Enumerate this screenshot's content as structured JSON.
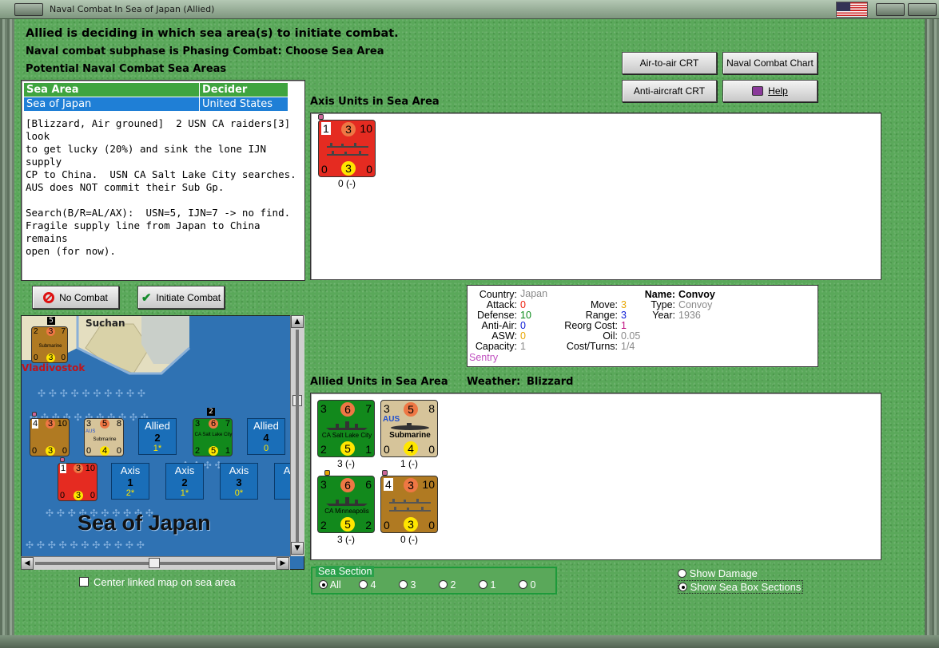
{
  "window": {
    "title": "Naval Combat In Sea of Japan (Allied)"
  },
  "status": {
    "line1": "Allied is deciding in which sea area(s) to initiate combat.",
    "line2": "Naval combat subphase is Phasing Combat: Choose Sea Area",
    "line3": "Potential Naval Combat Sea Areas"
  },
  "sea_table": {
    "headers": [
      "Sea Area",
      "Decider"
    ],
    "rows": [
      [
        "Sea of Japan",
        "United States"
      ]
    ]
  },
  "notes": "[Blizzard, Air grouned]  2 USN CA raiders[3] look\nto get lucky (20%) and sink the lone IJN supply\nCP to China.  USN CA Salt Lake City searches.\nAUS does NOT commit their Sub Gp.\n\nSearch(B/R=AL/AX):  USN=5, IJN=7 -> no find.\nFragile supply line from Japan to China remains\nopen (for now).",
  "buttons": {
    "air_to_air": "Air-to-air CRT",
    "naval_chart": "Naval Combat Chart",
    "anti_aircraft": "Anti-aircraft CRT",
    "help": "Help",
    "no_combat": "No Combat",
    "initiate_combat": "Initiate Combat"
  },
  "axis_section": {
    "label": "Axis Units in Sea Area",
    "unit": {
      "tl": "1",
      "tc": "3",
      "tr": "10",
      "bl": "0",
      "bc": "3",
      "br": "0",
      "under": "0 (-)"
    }
  },
  "info": {
    "country_k": "Country:",
    "country_v": "Japan",
    "attack_k": "Attack:",
    "attack_v": "0",
    "defense_k": "Defense:",
    "defense_v": "10",
    "antiair_k": "Anti-Air:",
    "antiair_v": "0",
    "asw_k": "ASW:",
    "asw_v": "0",
    "capacity_k": "Capacity:",
    "capacity_v": "1",
    "sentry": "Sentry",
    "move_k": "Move:",
    "move_v": "3",
    "range_k": "Range:",
    "range_v": "3",
    "reorg_k": "Reorg Cost:",
    "reorg_v": "1",
    "oil_k": "Oil:",
    "oil_v": "0.05",
    "cost_k": "Cost/Turns:",
    "cost_v": "1/4",
    "name_k": "Name:",
    "name_v": "Convoy",
    "type_k": "Type:",
    "type_v": "Convoy",
    "year_k": "Year:",
    "year_v": "1936"
  },
  "allied_section": {
    "label": "Allied Units in Sea Area",
    "weather_k": "Weather:",
    "weather_v": "Blizzard",
    "units": [
      {
        "tl": "3",
        "tc": "6",
        "tr": "7",
        "bl": "2",
        "bc": "5",
        "br": "1",
        "name": "CA Salt Lake City",
        "under": "3 (-)"
      },
      {
        "tl": "3",
        "tc": "5",
        "tr": "8",
        "bl": "0",
        "bc": "4",
        "br": "0",
        "name": "Submarine",
        "nation": "AUS",
        "under": "1 (-)"
      },
      {
        "tl": "3",
        "tc": "6",
        "tr": "6",
        "bl": "2",
        "bc": "5",
        "br": "2",
        "name": "CA Minneapolis",
        "under": "3 (-)"
      },
      {
        "tl": "4",
        "tc": "3",
        "tr": "10",
        "bl": "0",
        "bc": "3",
        "br": "0",
        "under": "0 (-)"
      }
    ]
  },
  "map": {
    "title": "Sea of Japan",
    "suchan": "Suchan",
    "vladivostok": "Vladivostok",
    "stack_count_1": "5",
    "stack_count_2": "2",
    "sub_counter": {
      "tl": "2",
      "tc": "3",
      "tr": "7",
      "bl": "0",
      "bc": "3",
      "br": "0",
      "name": "Submarine"
    },
    "row1": [
      {
        "tl": "4",
        "tc": "3",
        "tr": "10",
        "bl": "0",
        "bc": "3",
        "br": "0"
      },
      {
        "tl": "3",
        "tc": "5",
        "tr": "8",
        "bl": "0",
        "bc": "4",
        "br": "0",
        "name": "Submarine",
        "nation": "AUS"
      },
      {
        "a": "Allied",
        "b": "2",
        "c": "1*"
      },
      {
        "tl": "3",
        "tc": "6",
        "tr": "7",
        "bl": "2",
        "bc": "5",
        "br": "1",
        "name": "CA Salt Lake City"
      },
      {
        "a": "Allied",
        "b": "4",
        "c": "0"
      }
    ],
    "row2": [
      {
        "tl": "1",
        "tc": "3",
        "tr": "10",
        "bl": "0",
        "bc": "3",
        "br": "0"
      },
      {
        "a": "Axis",
        "b": "1",
        "c": "2*"
      },
      {
        "a": "Axis",
        "b": "2",
        "c": "1*"
      },
      {
        "a": "Axis",
        "b": "3",
        "c": "0*"
      },
      {
        "a": "Axis"
      }
    ]
  },
  "center_map": "Center linked map on sea area",
  "sea_section": {
    "legend": "Sea Section",
    "options": [
      "All",
      "4",
      "3",
      "2",
      "1",
      "0"
    ],
    "selected": "All"
  },
  "show_damage": "Show Damage",
  "show_boxes": "Show Sea Box Sections",
  "colors": {
    "felt": "#5aa85a",
    "header_green": "#3fa43f",
    "select_blue": "#1f7fd6",
    "axis_red": "#e52b21",
    "usa_green": "#12891c"
  }
}
